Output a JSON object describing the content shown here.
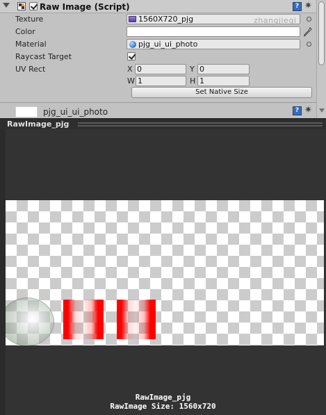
{
  "component": {
    "title": "Raw Image (Script)",
    "enabled": true,
    "help_symbol": "?",
    "gear_symbol": "✷"
  },
  "fields": {
    "texture_label": "Texture",
    "texture_value": "1560X720_pjg",
    "color_label": "Color",
    "color_value": "#ffffff",
    "material_label": "Material",
    "material_value": "pjg_ui_ui_photo",
    "raycast_label": "Raycast Target",
    "raycast_checked": true,
    "uvrect_label": "UV Rect",
    "uv": {
      "x_label": "X",
      "x": "0",
      "y_label": "Y",
      "y": "0",
      "w_label": "W",
      "w": "1",
      "h_label": "H",
      "h": "1"
    },
    "set_native_size_label": "Set Native Size"
  },
  "watermark": "zhangjieqi",
  "material_section": {
    "name": "pjg_ui_ui_photo"
  },
  "preview": {
    "header_title": "RawImage_pjg",
    "caption_name": "RawImage_pjg",
    "caption_size": "RawImage Size: 1560x720"
  },
  "icons": {
    "foldout": "foldout-arrow-icon",
    "component": "raw-image-component-icon",
    "texture": "texture-thumbnail-icon",
    "material": "material-sphere-icon",
    "picker": "object-picker-icon",
    "eyedropper": "eyedropper-icon"
  },
  "colors": {
    "inspector_bg": "#c2c2c2",
    "preview_bg": "#333333",
    "accent_red": "#ff0000",
    "help_blue": "#3b6cb7"
  }
}
